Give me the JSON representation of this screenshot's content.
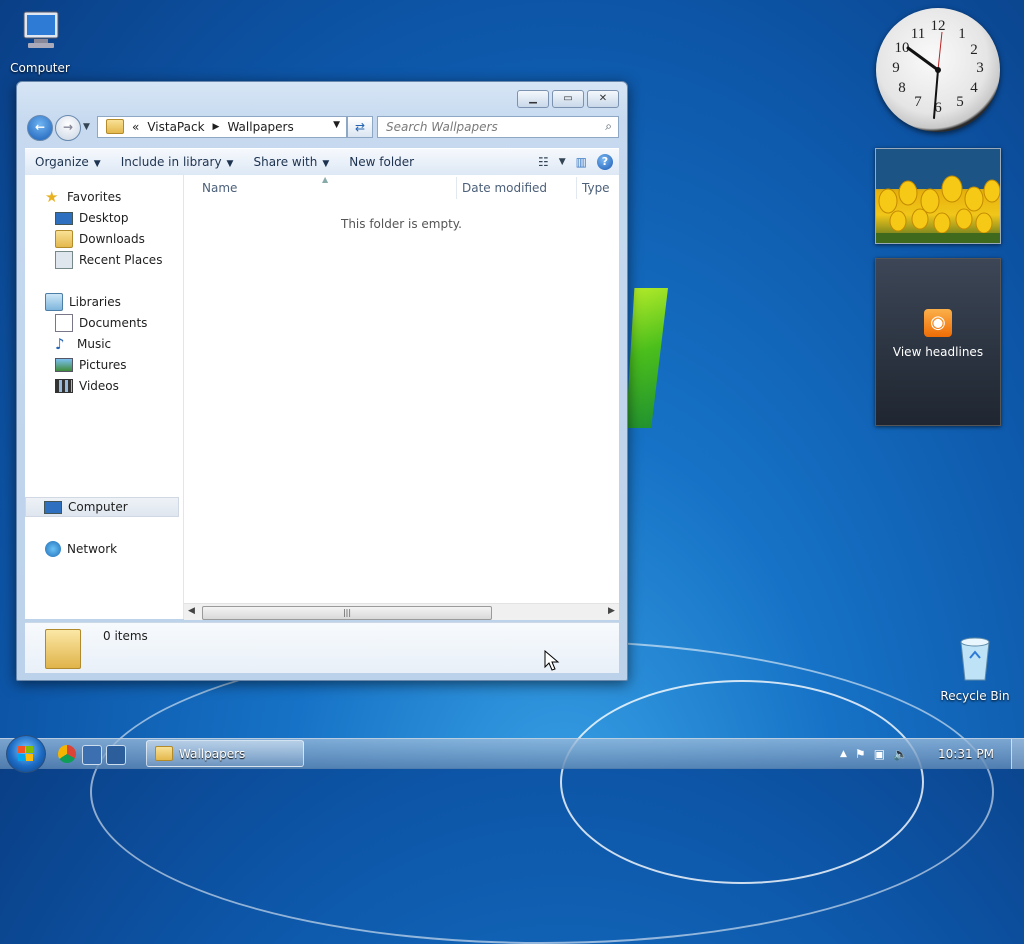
{
  "desktop": {
    "icons": [
      {
        "label": "Computer"
      },
      {
        "label": "Recycle Bin"
      }
    ]
  },
  "gadgets": {
    "clock_numbers": [
      "12",
      "1",
      "2",
      "3",
      "4",
      "5",
      "6",
      "7",
      "8",
      "9",
      "10",
      "11"
    ],
    "feed_label": "View headlines"
  },
  "window": {
    "address": {
      "overflow": "«",
      "crumbs": [
        "VistaPack",
        "Wallpapers"
      ]
    },
    "search_placeholder": "Search Wallpapers",
    "toolbar": {
      "organize": "Organize",
      "include_in_library": "Include in library",
      "share_with": "Share with",
      "new_folder": "New folder"
    },
    "nav": {
      "favorites": "Favorites",
      "desktop": "Desktop",
      "downloads": "Downloads",
      "recent_places": "Recent Places",
      "libraries": "Libraries",
      "documents": "Documents",
      "music": "Music",
      "pictures": "Pictures",
      "videos": "Videos",
      "computer": "Computer",
      "network": "Network"
    },
    "columns": {
      "name": "Name",
      "date_modified": "Date modified",
      "type": "Type"
    },
    "empty_message": "This folder is empty.",
    "details_count": "0 items"
  },
  "taskbar": {
    "open_window": "Wallpapers",
    "time": "10:31 PM"
  }
}
